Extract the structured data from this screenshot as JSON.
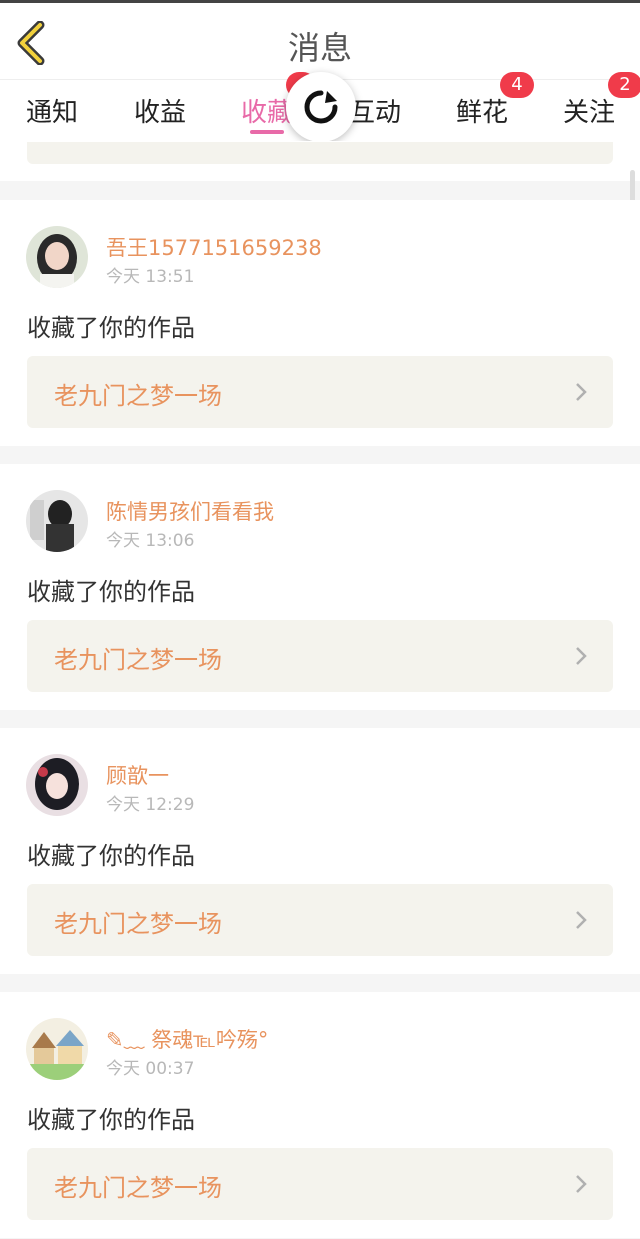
{
  "header": {
    "title": "消息"
  },
  "tabs": [
    {
      "label": "通知",
      "active": false,
      "badge": ""
    },
    {
      "label": "收益",
      "active": false,
      "badge": ""
    },
    {
      "label": "收藏",
      "active": true,
      "badge": ""
    },
    {
      "label": "互动",
      "active": false,
      "badge": ""
    },
    {
      "label": "鲜花",
      "active": false,
      "badge": "4"
    },
    {
      "label": "关注",
      "active": false,
      "badge": "2"
    }
  ],
  "colors": {
    "accent": "#e86aa8",
    "name": "#e8935e",
    "badge": "#f03b4a"
  },
  "items": [
    {
      "name": "吾王1577151659238",
      "time": "今天 13:51",
      "action": "收藏了你的作品",
      "work": "老九门之梦一场"
    },
    {
      "name": "陈情男孩们看看我",
      "time": "今天 13:06",
      "action": "收藏了你的作品",
      "work": "老九门之梦一场"
    },
    {
      "name": "顾歆一",
      "time": "今天 12:29",
      "action": "收藏了你的作品",
      "work": "老九门之梦一场"
    },
    {
      "name": "✎﹏ 祭魂℡吟殇°",
      "time": "今天 00:37",
      "action": "收藏了你的作品",
      "work": "老九门之梦一场"
    }
  ]
}
